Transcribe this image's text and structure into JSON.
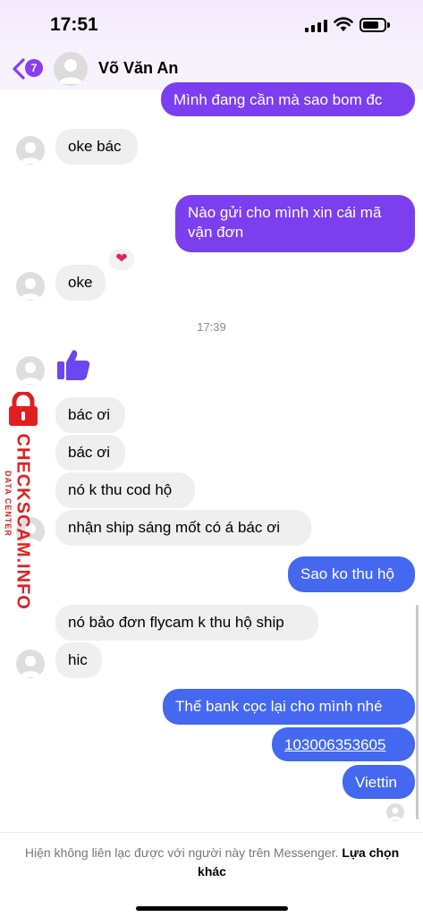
{
  "status": {
    "time": "17:51"
  },
  "header": {
    "back_count": "7",
    "contact_name": "Võ Văn An"
  },
  "messages": [
    {
      "from": "me",
      "text": "Mình đang cần mà sao bom đc"
    },
    {
      "from": "them",
      "text": "oke bác",
      "reaction": "heart"
    },
    {
      "from": "me",
      "text_line1": "Nào gửi cho mình xin cái mã",
      "text_line2": "vận đơn"
    },
    {
      "from": "them",
      "text": "oke"
    },
    {
      "timestamp": "17:39"
    },
    {
      "from": "them",
      "type": "like"
    },
    {
      "from": "them",
      "text": "bác ơi"
    },
    {
      "from": "them",
      "text": "bác ơi"
    },
    {
      "from": "them",
      "text": "nó k thu cod hộ"
    },
    {
      "from": "them",
      "text": "nhận ship sáng mốt có á bác ơi"
    },
    {
      "from": "me",
      "text": "Sao ko thu hộ"
    },
    {
      "from": "them",
      "text": "nó bảo đơn flycam k thu hộ ship"
    },
    {
      "from": "them",
      "text": "hic"
    },
    {
      "from": "me",
      "text": "Thế bank cọc lại cho mình nhé"
    },
    {
      "from": "me",
      "text": "103006353605"
    },
    {
      "from": "me",
      "text": "Viettin"
    }
  ],
  "watermark": {
    "main": "CHECKSCAM.INFO",
    "sub": "DATA CENTER"
  },
  "footer": {
    "notice": "Hiện không liên lạc được với người này trên Messenger.",
    "link": "Lựa chọn khác"
  },
  "colors": {
    "purple": "#7b3ff0",
    "blue": "#4468f0",
    "incoming": "#efefef",
    "watermark": "#e02020"
  }
}
